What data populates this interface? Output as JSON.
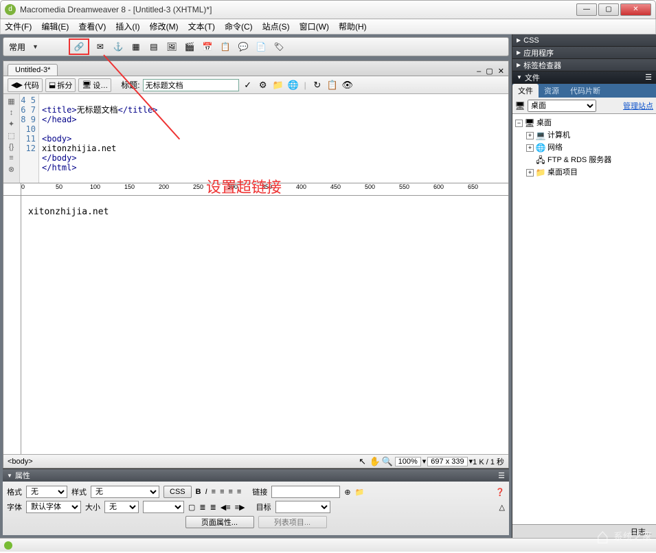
{
  "title": "Macromedia Dreamweaver 8 - [Untitled-3 (XHTML)*]",
  "menubar": [
    "文件(F)",
    "编辑(E)",
    "查看(V)",
    "插入(I)",
    "修改(M)",
    "文本(T)",
    "命令(C)",
    "站点(S)",
    "窗口(W)",
    "帮助(H)"
  ],
  "toolbar_label": "常用",
  "toolbar_icons": [
    "hyperlink",
    "email",
    "table",
    "image",
    "media",
    "calendar",
    "date",
    "comment",
    "template",
    "tag"
  ],
  "doc_tab": "Untitled-3*",
  "view_buttons": {
    "code": "代码",
    "split": "拆分",
    "design": "设…"
  },
  "title_label": "标题:",
  "title_value": "无标题文档",
  "line_numbers": [
    "4",
    "5",
    "6",
    "7",
    "8",
    "9",
    "10",
    "11",
    "12"
  ],
  "code_lines": [
    {
      "t": "",
      "p": ""
    },
    {
      "t": "<title>",
      "x": "无标题文档",
      "c": "</title>"
    },
    {
      "t": "</head>",
      "x": "",
      "c": ""
    },
    {
      "t": "",
      "x": "",
      "c": ""
    },
    {
      "t": "<body>",
      "x": "",
      "c": ""
    },
    {
      "t": "",
      "x": "xitonzhijia.net",
      "c": ""
    },
    {
      "t": "</body>",
      "x": "",
      "c": ""
    },
    {
      "t": "</html>",
      "x": "",
      "c": ""
    },
    {
      "t": "",
      "x": "",
      "c": ""
    }
  ],
  "ruler_ticks": [
    "0",
    "50",
    "100",
    "150",
    "200",
    "250",
    "300",
    "350",
    "400",
    "450",
    "500",
    "550",
    "600",
    "650"
  ],
  "design_text": "xitonzhijia.net",
  "annotation_text": "设置超链接",
  "status_left": "<body>",
  "zoom": "100%",
  "dims": "697 x 339",
  "size": "1 K / 1 秒",
  "properties": {
    "header": "属性",
    "format_label": "格式",
    "format_value": "无",
    "style_label": "样式",
    "style_value": "无",
    "css_btn": "CSS",
    "link_label": "链接",
    "font_label": "字体",
    "font_value": "默认字体",
    "size_label": "大小",
    "size_value": "无",
    "target_label": "目标",
    "page_props_btn": "页面属性...",
    "list_item_btn": "列表项目..."
  },
  "panels": {
    "css": "CSS",
    "app": "应用程序",
    "tag": "标签检查器",
    "files": "文件"
  },
  "file_tabs": [
    "文件",
    "资源",
    "代码片断"
  ],
  "desktop_label": "桌面",
  "manage_site": "管理站点",
  "tree": {
    "root": "桌面",
    "items": [
      "计算机",
      "网络",
      "FTP & RDS 服务器",
      "桌面项目"
    ]
  },
  "watermark": "系统之家"
}
